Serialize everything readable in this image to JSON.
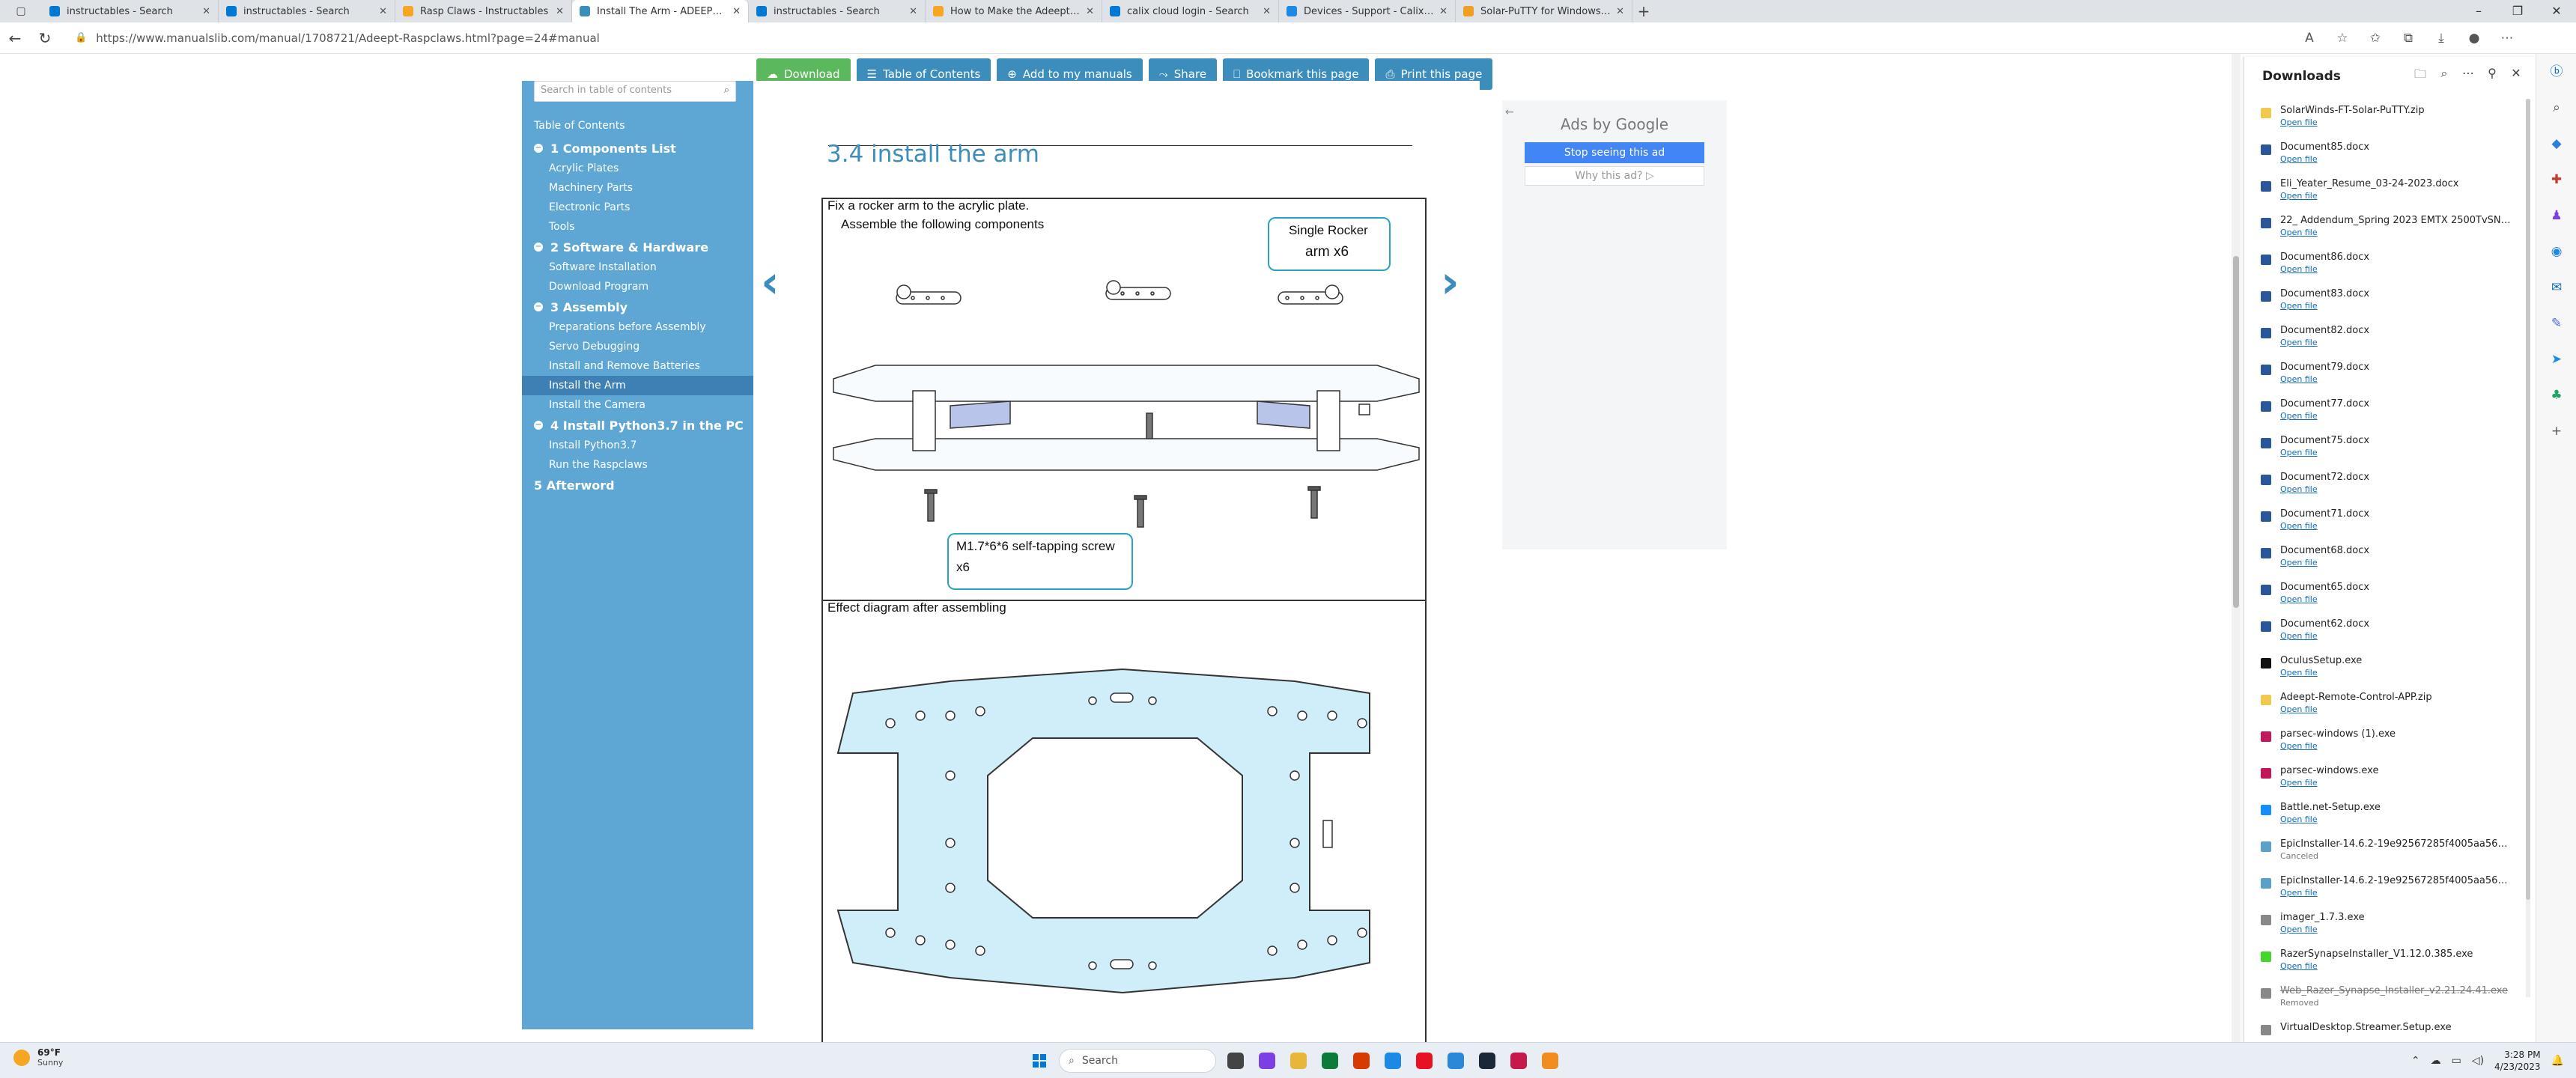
{
  "browser": {
    "tabs": [
      {
        "title": "instructables - Search",
        "favicon_color": "#0078d4",
        "icon": "search-icon",
        "active": false
      },
      {
        "title": "instructables - Search",
        "favicon_color": "#0078d4",
        "icon": "search-icon",
        "active": false
      },
      {
        "title": "Rasp Claws - Instructables",
        "favicon_color": "#f5a623",
        "icon": "robot-icon",
        "active": false
      },
      {
        "title": "Install The Arm - ADEEPT RaspC...",
        "favicon_color": "#3c8dbc",
        "icon": "manualslib-icon",
        "active": true
      },
      {
        "title": "instructables - Search",
        "favicon_color": "#0078d4",
        "icon": "search-icon",
        "active": false
      },
      {
        "title": "How to Make the Adeept Raspcl...",
        "favicon_color": "#f5a623",
        "icon": "robot-icon",
        "active": false
      },
      {
        "title": "calix cloud login - Search",
        "favicon_color": "#0078d4",
        "icon": "search-icon",
        "active": false
      },
      {
        "title": "Devices - Support - Calix Cloud",
        "favicon_color": "#1e88e5",
        "icon": "cloud-icon",
        "active": false
      },
      {
        "title": "Solar-PuTTY for Windows - Free...",
        "favicon_color": "#f0a020",
        "icon": "putty-icon",
        "active": false
      }
    ],
    "url": "https://www.manualslib.com/manual/1708721/Adeept-Raspclaws.html?page=24#manual"
  },
  "toolbar": {
    "download": "Download",
    "toc": "Table of Contents",
    "add": "Add to my manuals",
    "share": "Share",
    "bookmark": "Bookmark this page",
    "print": "Print this page"
  },
  "sidebar": {
    "search_placeholder": "Search in table of contents",
    "toc_heading": "Table of Contents",
    "chapters": [
      {
        "label": "1 Components List",
        "items": [
          "Acrylic Plates",
          "Machinery Parts",
          "Electronic Parts",
          "Tools"
        ]
      },
      {
        "label": "2 Software & Hardware",
        "items": [
          "Software Installation",
          "Download Program"
        ]
      },
      {
        "label": "3 Assembly",
        "items": [
          "Preparations before Assembly",
          "Servo Debugging",
          "Install and Remove Batteries",
          "Install the Arm",
          "Install the Camera"
        ]
      },
      {
        "label": "4 Install Python3.7 in the PC",
        "items": [
          "Install Python3.7",
          "Run the Raspclaws"
        ]
      },
      {
        "label": "5 Afterword",
        "items": []
      }
    ],
    "active_item": "Install the Arm"
  },
  "content": {
    "heading": "3.4 install the arm",
    "step_text": "Fix a rocker arm to the acrylic plate.",
    "assemble_text": "Assemble the following components",
    "callout_rocker_line1": "Single Rocker",
    "callout_rocker_line2": "arm x6",
    "callout_screw_line1": "M1.7*6*6 self-tapping screw",
    "callout_screw_line2": "x6",
    "effect_caption": "Effect diagram after assembling"
  },
  "ad": {
    "ads_by": "Ads by Google",
    "stop": "Stop seeing this ad",
    "why": "Why this ad? ▷"
  },
  "downloads": {
    "title": "Downloads",
    "items": [
      {
        "name": "SolarWinds-FT-Solar-PuTTY.zip",
        "action": "Open file",
        "color": "#f2c94c",
        "strike": false
      },
      {
        "name": "Document85.docx",
        "action": "Open file",
        "color": "#2b579a",
        "strike": false
      },
      {
        "name": "Eli_Yeater_Resume_03-24-2023.docx",
        "action": "Open file",
        "color": "#2b579a",
        "strike": false
      },
      {
        "name": "22_ Addendum_Spring 2023 EMTX 2500TvSNoA(1).docx",
        "action": "Open file",
        "color": "#2b579a",
        "strike": false
      },
      {
        "name": "Document86.docx",
        "action": "Open file",
        "color": "#2b579a",
        "strike": false
      },
      {
        "name": "Document83.docx",
        "action": "Open file",
        "color": "#2b579a",
        "strike": false
      },
      {
        "name": "Document82.docx",
        "action": "Open file",
        "color": "#2b579a",
        "strike": false
      },
      {
        "name": "Document79.docx",
        "action": "Open file",
        "color": "#2b579a",
        "strike": false
      },
      {
        "name": "Document77.docx",
        "action": "Open file",
        "color": "#2b579a",
        "strike": false
      },
      {
        "name": "Document75.docx",
        "action": "Open file",
        "color": "#2b579a",
        "strike": false
      },
      {
        "name": "Document72.docx",
        "action": "Open file",
        "color": "#2b579a",
        "strike": false
      },
      {
        "name": "Document71.docx",
        "action": "Open file",
        "color": "#2b579a",
        "strike": false
      },
      {
        "name": "Document68.docx",
        "action": "Open file",
        "color": "#2b579a",
        "strike": false
      },
      {
        "name": "Document65.docx",
        "action": "Open file",
        "color": "#2b579a",
        "strike": false
      },
      {
        "name": "Document62.docx",
        "action": "Open file",
        "color": "#2b579a",
        "strike": false
      },
      {
        "name": "OculusSetup.exe",
        "action": "Open file",
        "color": "#111111",
        "strike": false
      },
      {
        "name": "Adeept-Remote-Control-APP.zip",
        "action": "Open file",
        "color": "#f2c94c",
        "strike": false
      },
      {
        "name": "parsec-windows (1).exe",
        "action": "Open file",
        "color": "#c2185b",
        "strike": false
      },
      {
        "name": "parsec-windows.exe",
        "action": "Open file",
        "color": "#c2185b",
        "strike": false
      },
      {
        "name": "Battle.net-Setup.exe",
        "action": "Open file",
        "color": "#148eff",
        "strike": false
      },
      {
        "name": "EpicInstaller-14.6.2-19e92567285f4005aa56671c60883e6...",
        "action": "Canceled",
        "color": "#5aa0c8",
        "strike": false
      },
      {
        "name": "EpicInstaller-14.6.2-19e92567285f4005aa56671c60883e6...",
        "action": "Open file",
        "color": "#5aa0c8",
        "strike": false
      },
      {
        "name": "imager_1.7.3.exe",
        "action": "Open file",
        "color": "#888888",
        "strike": false
      },
      {
        "name": "RazerSynapseInstaller_V1.12.0.385.exe",
        "action": "Open file",
        "color": "#44d62c",
        "strike": false
      },
      {
        "name": "Web_Razer_Synapse_Installer_v2.21.24.41.exe",
        "action": "Removed",
        "color": "#888888",
        "strike": true
      },
      {
        "name": "VirtualDesktop.Streamer.Setup.exe",
        "action": "",
        "color": "#888888",
        "strike": false
      }
    ]
  },
  "taskbar": {
    "temp": "69°F",
    "condition": "Sunny",
    "search": "Search",
    "time": "3:28 PM",
    "date": "4/23/2023",
    "apps": [
      "#444444",
      "#7b3fe4",
      "#e8b73a",
      "#0e7a3a",
      "#d83b01",
      "#1e88e5",
      "#e81123",
      "#2b88d8",
      "#1b2838",
      "#c51a4a",
      "#f28c1e"
    ]
  }
}
